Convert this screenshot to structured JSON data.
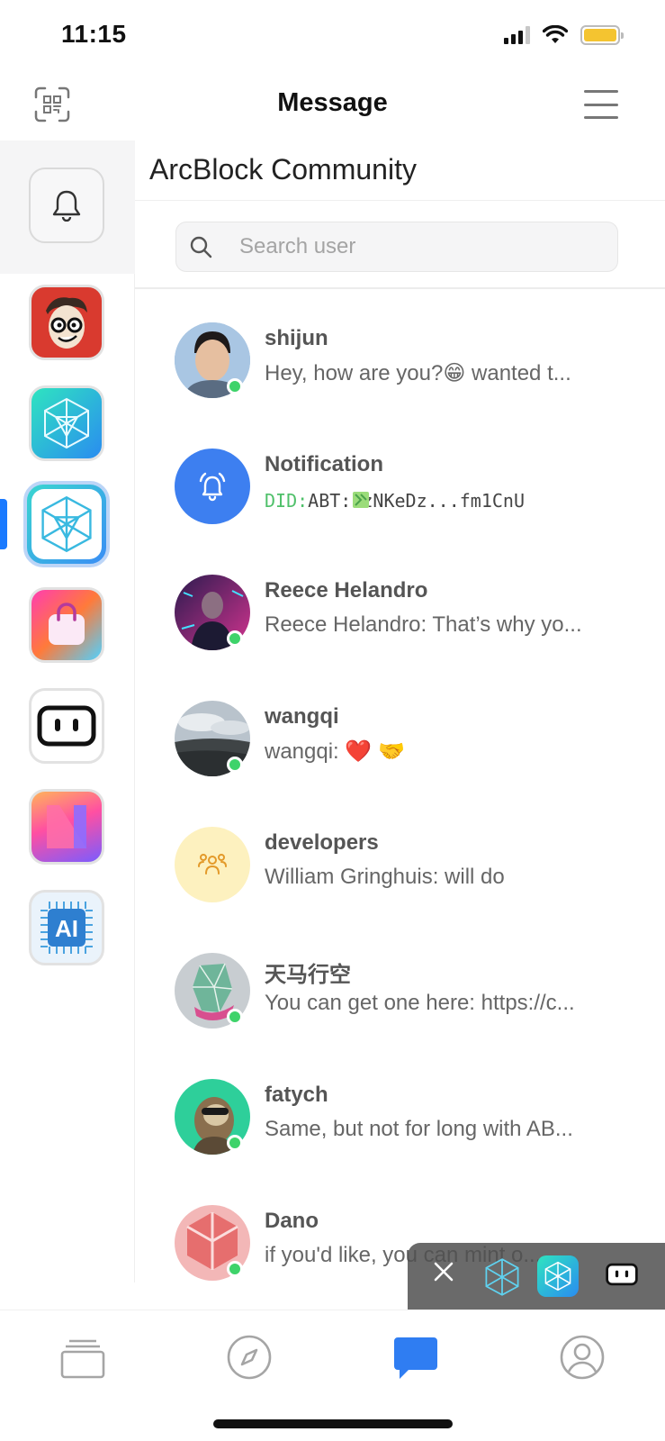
{
  "status_bar": {
    "time": "11:15"
  },
  "header": {
    "title": "Message"
  },
  "community": {
    "title": "ArcBlock Community"
  },
  "search": {
    "placeholder": "Search user"
  },
  "chats": [
    {
      "name": "shijun",
      "preview": "Hey, how are you?😁 wanted t...",
      "online": true
    },
    {
      "name": "Notification",
      "preview_prefix": "DID:",
      "preview": "ABT: zNKeDz...fm1CnU",
      "online": false
    },
    {
      "name": "Reece Helandro",
      "preview": "Reece Helandro: That’s why yo...",
      "online": true
    },
    {
      "name": "wangqi",
      "preview": "wangqi: ❤️ 🤝",
      "online": true
    },
    {
      "name": "developers",
      "preview": "William Gringhuis: will do",
      "online": false
    },
    {
      "name": "天马行空",
      "preview": "You can get one here: https://c...",
      "online": true
    },
    {
      "name": "fatych",
      "preview": "Same, but not for long with AB...",
      "online": true
    },
    {
      "name": "Dano",
      "preview": "if you'd like, you can mint o...",
      "online": true
    }
  ],
  "colors": {
    "accent": "#1a7aff",
    "online": "#3ed36a"
  },
  "tabs": [
    "wallet-icon",
    "explore-icon",
    "message-icon",
    "profile-icon"
  ]
}
